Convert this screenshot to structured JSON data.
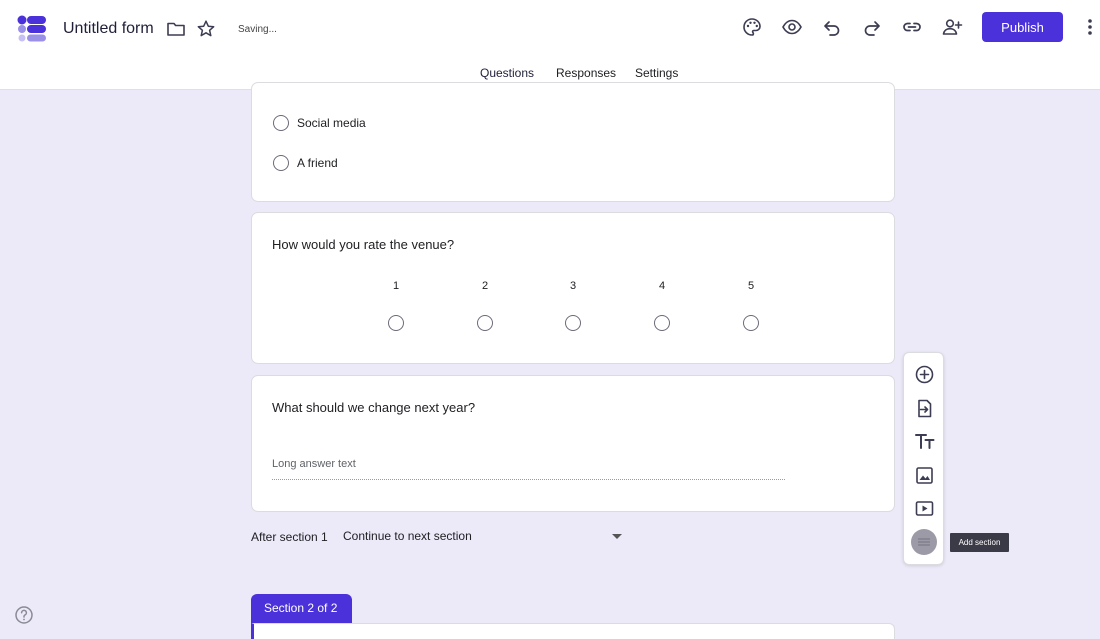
{
  "header": {
    "title": "Untitled form",
    "status": "Saving...",
    "publish_label": "Publish"
  },
  "tabs": [
    {
      "label": "Questions",
      "active": true
    },
    {
      "label": "Responses",
      "active": false
    },
    {
      "label": "Settings",
      "active": false
    }
  ],
  "question_prev": {
    "options": [
      "Social media",
      "A friend"
    ]
  },
  "question_rating": {
    "title": "How would you rate the venue?",
    "scale": [
      "1",
      "2",
      "3",
      "4",
      "5"
    ]
  },
  "question_long": {
    "title": "What should we change next year?",
    "placeholder": "Long answer text"
  },
  "section_nav": {
    "after_label": "After section 1",
    "selected": "Continue to next section"
  },
  "toolbar": {
    "tooltip": "Add section",
    "items": [
      "add-question-icon",
      "import-questions-icon",
      "add-title-icon",
      "add-image-icon",
      "add-video-icon",
      "add-section-icon"
    ]
  },
  "section2": {
    "label": "Section 2 of 2"
  },
  "colors": {
    "accent": "#4b31d9",
    "background": "#ece9f8"
  },
  "icons": [
    "forms-logo-icon",
    "folder-icon",
    "star-icon",
    "palette-icon",
    "preview-eye-icon",
    "undo-icon",
    "redo-icon",
    "link-icon",
    "add-collaborator-icon",
    "more-vert-icon",
    "help-icon"
  ]
}
